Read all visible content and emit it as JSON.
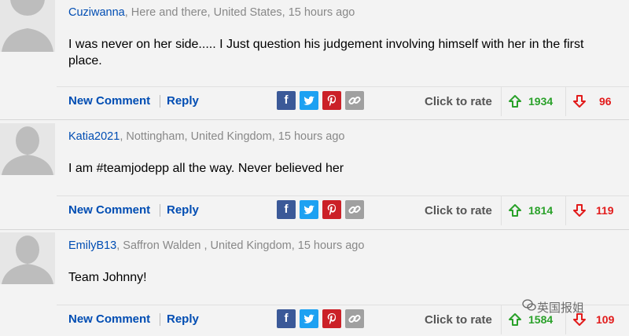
{
  "colors": {
    "username": "#004db3",
    "upvote": "#2aa12a",
    "downvote": "#e21b1b",
    "facebook": "#3b5998",
    "twitter": "#1da1f2",
    "pinterest": "#cb2027",
    "link": "#a0a0a0"
  },
  "actions": {
    "new_comment": "New Comment",
    "reply": "Reply",
    "click_to_rate": "Click to rate"
  },
  "share_icons": [
    "facebook-icon",
    "twitter-icon",
    "pinterest-icon",
    "link-icon"
  ],
  "comments": [
    {
      "username": "Cuziwanna",
      "location_time": ", Here and there, United States, 15 hours ago",
      "text": "I was never on her side..... I Just question his judgement involving himself with her in the first place.",
      "upvotes": "1934",
      "downvotes": "96"
    },
    {
      "username": "Katia2021",
      "location_time": ", Nottingham, United Kingdom, 15 hours ago",
      "text": "I am #teamjodepp all the way. Never believed her",
      "upvotes": "1814",
      "downvotes": "119"
    },
    {
      "username": "EmilyB13",
      "location_time": ", Saffron Walden , United Kingdom, 15 hours ago",
      "text": "Team Johnny!",
      "upvotes": "1584",
      "downvotes": "109"
    }
  ],
  "watermark": "英国报姐"
}
